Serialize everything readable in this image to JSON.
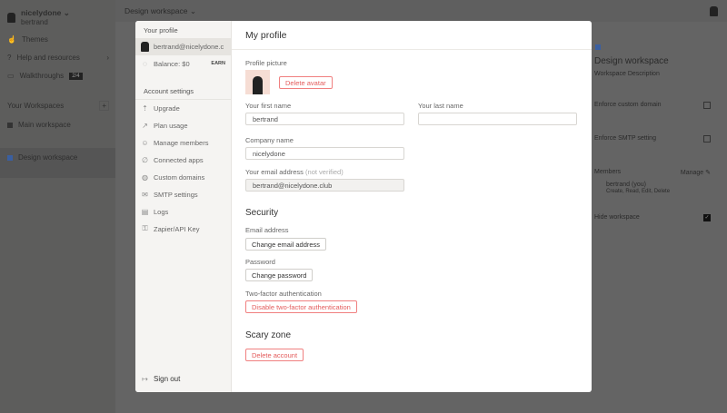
{
  "sidebar": {
    "org": "nicelydone",
    "user": "bertrand",
    "items": [
      {
        "label": "Themes",
        "icon": "thumb-icon"
      },
      {
        "label": "Help and resources",
        "icon": "question-icon"
      },
      {
        "label": "Walkthroughs",
        "badge": "2/4",
        "icon": "chat-icon"
      }
    ],
    "workspaces_title": "Your Workspaces",
    "workspaces": [
      {
        "name": "Main workspace",
        "color": "#333333"
      },
      {
        "name": "Design workspace",
        "color": "#3a5fa0"
      }
    ]
  },
  "topbar": {
    "workspace": "Design workspace"
  },
  "right_panel": {
    "title": "Design workspace",
    "description": "Workspace Description",
    "enforce_domain": "Enforce custom domain",
    "enforce_smtp": "Enforce SMTP setting",
    "members": "Members",
    "manage": "Manage",
    "member_name": "bertrand (you)",
    "member_perms": "Create, Read, Edit, Delete",
    "hide": "Hide workspace",
    "help": "?"
  },
  "modal": {
    "nav": {
      "profile_header": "Your profile",
      "email": "bertrand@nicelydone.c",
      "balance": "Balance: $0",
      "earn": "EARN",
      "settings_header": "Account settings",
      "items": [
        {
          "label": "Upgrade",
          "icon": "⇡"
        },
        {
          "label": "Plan usage",
          "icon": "↗"
        },
        {
          "label": "Manage members",
          "icon": "☺"
        },
        {
          "label": "Connected apps",
          "icon": "∅"
        },
        {
          "label": "Custom domains",
          "icon": "◍"
        },
        {
          "label": "SMTP settings",
          "icon": "✉"
        },
        {
          "label": "Logs",
          "icon": "▤"
        },
        {
          "label": "Zapier/API Key",
          "icon": "⚿"
        }
      ],
      "sign_out": "Sign out"
    },
    "title": "My profile",
    "profile_picture": "Profile picture",
    "delete_avatar": "Delete avatar",
    "first_name_label": "Your first name",
    "first_name": "bertrand",
    "last_name_label": "Your last name",
    "last_name": "",
    "company_label": "Company name",
    "company": "nicelydone",
    "email_label": "Your email address",
    "email_note": "(not verified)",
    "email": "bertrand@nicelydone.club",
    "security": "Security",
    "email_address": "Email address",
    "change_email": "Change email address",
    "password": "Password",
    "change_password": "Change password",
    "twofa": "Two-factor authentication",
    "disable_twofa": "Disable two-factor authentication",
    "scary": "Scary zone",
    "delete_account": "Delete account"
  }
}
